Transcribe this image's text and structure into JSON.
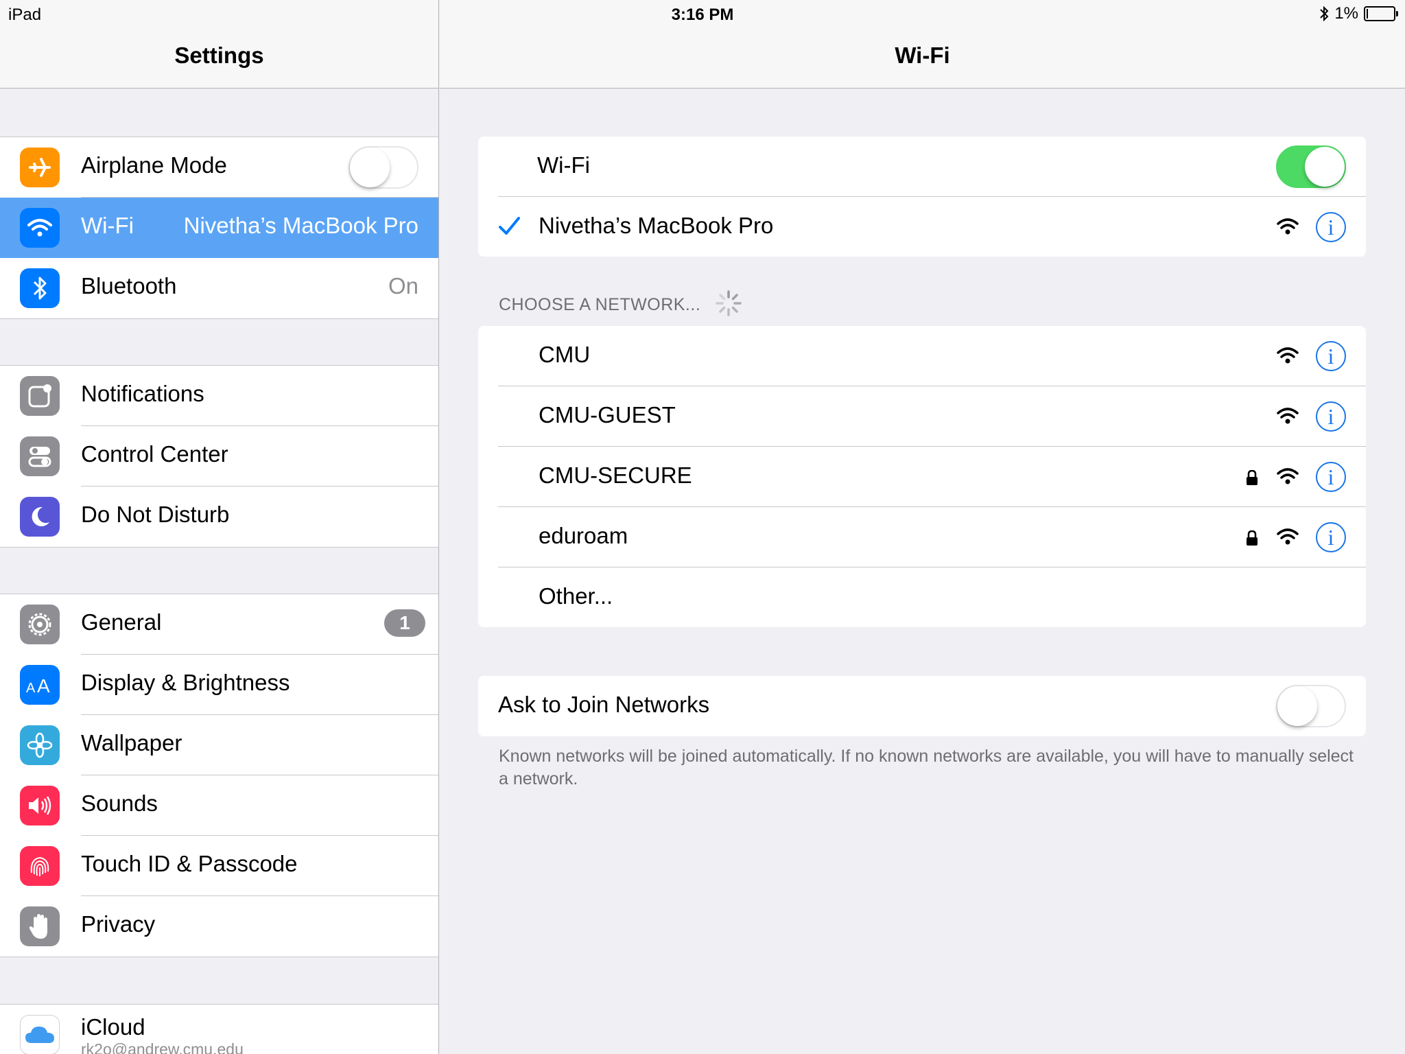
{
  "status_bar": {
    "device": "iPad",
    "time": "3:16 PM",
    "battery": "1%",
    "battery_level": 0.01
  },
  "sidebar": {
    "title": "Settings",
    "groups": [
      [
        {
          "label": "Airplane Mode",
          "icon": "airplane-icon",
          "color": "#ff9500",
          "toggle": false
        },
        {
          "label": "Wi-Fi",
          "value": "Nivetha’s MacBook Pro",
          "icon": "wifi-icon",
          "color": "#007aff",
          "selected": true
        },
        {
          "label": "Bluetooth",
          "value": "On",
          "icon": "bluetooth-icon",
          "color": "#007aff"
        }
      ],
      [
        {
          "label": "Notifications",
          "icon": "notifications-icon",
          "color": "#8e8e93"
        },
        {
          "label": "Control Center",
          "icon": "control-center-icon",
          "color": "#8e8e93"
        },
        {
          "label": "Do Not Disturb",
          "icon": "moon-icon",
          "color": "#5856d6"
        }
      ],
      [
        {
          "label": "General",
          "icon": "gear-icon",
          "color": "#8e8e93",
          "badge": "1"
        },
        {
          "label": "Display & Brightness",
          "icon": "display-brightness-icon",
          "color": "#007aff"
        },
        {
          "label": "Wallpaper",
          "icon": "wallpaper-icon",
          "color": "#34aadc"
        },
        {
          "label": "Sounds",
          "icon": "speaker-icon",
          "color": "#ff2d55"
        },
        {
          "label": "Touch ID & Passcode",
          "icon": "fingerprint-icon",
          "color": "#ff2d55"
        },
        {
          "label": "Privacy",
          "icon": "hand-icon",
          "color": "#8e8e93"
        }
      ],
      [
        {
          "label": "iCloud",
          "sublabel": "rk2o@andrew.cmu.edu",
          "icon": "icloud-icon",
          "color": "#ffffff"
        }
      ]
    ]
  },
  "detail": {
    "title": "Wi-Fi",
    "wifi_label": "Wi-Fi",
    "wifi_on": true,
    "connected_network": "Nivetha’s MacBook Pro",
    "choose_header": "CHOOSE A NETWORK...",
    "networks": [
      {
        "name": "CMU",
        "locked": false
      },
      {
        "name": "CMU-GUEST",
        "locked": false
      },
      {
        "name": "CMU-SECURE",
        "locked": true
      },
      {
        "name": "eduroam",
        "locked": true
      }
    ],
    "other_label": "Other...",
    "ask_to_join_label": "Ask to Join Networks",
    "ask_to_join_on": false,
    "ask_to_join_note": "Known networks will be joined automatically. If no known networks are available, you will have to manually select a network.",
    "accent_color": "#007aff",
    "toggle_on_color": "#4cd964"
  }
}
